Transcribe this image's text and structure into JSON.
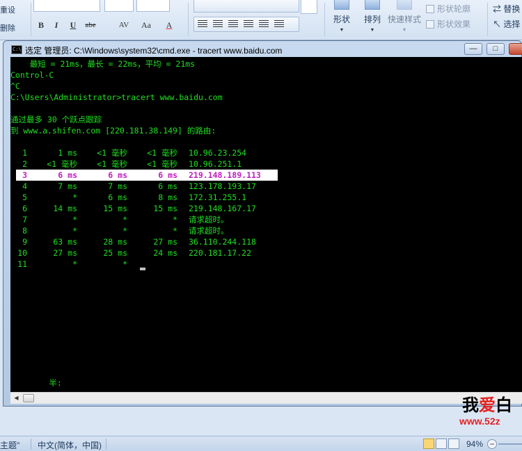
{
  "ribbon": {
    "left_labels": [
      "重设",
      "删除"
    ],
    "font_buttons": [
      "B",
      "I",
      "U",
      "abe",
      "AV",
      "Aa",
      "A"
    ],
    "groups": [
      {
        "label": "形状"
      },
      {
        "label": "排列"
      },
      {
        "label": "快速样式"
      }
    ],
    "shape_options": [
      "形状轮廓",
      "形状效果"
    ],
    "right_options": [
      "替换",
      "选择"
    ]
  },
  "cmd": {
    "title": "选定 管理员: C:\\Windows\\system32\\cmd.exe - tracert  www.baidu.com",
    "buttons": {
      "minimize": "—",
      "maximize": "□",
      "close": "✕"
    },
    "lines": {
      "l1": "    最短 = 21ms，最长 = 22ms，平均 = 21ms",
      "l2": "Control-C",
      "l3": "^C",
      "l4": "C:\\Users\\Administrator>tracert www.baidu.com",
      "l5": "通过最多 30 个跃点跟踪",
      "l6": "到 www.a.shifen.com [220.181.38.149] 的路由:",
      "footer": "        半:"
    },
    "hops": [
      {
        "n": "1",
        "t1": "1 ms",
        "t2": "<1 毫秒",
        "t3": "<1 毫秒",
        "addr": "10.96.23.254"
      },
      {
        "n": "2",
        "t1": "<1 毫秒",
        "t2": "<1 毫秒",
        "t3": "<1 毫秒",
        "addr": "10.96.251.1"
      },
      {
        "n": "3",
        "t1": "6 ms",
        "t2": "6 ms",
        "t3": "6 ms",
        "addr": "219.148.189.113"
      },
      {
        "n": "4",
        "t1": "7 ms",
        "t2": "7 ms",
        "t3": "6 ms",
        "addr": "123.178.193.17"
      },
      {
        "n": "5",
        "t1": "*",
        "t2": "6 ms",
        "t3": "8 ms",
        "addr": "172.31.255.1"
      },
      {
        "n": "6",
        "t1": "14 ms",
        "t2": "15 ms",
        "t3": "15 ms",
        "addr": "219.148.167.17"
      },
      {
        "n": "7",
        "t1": "*",
        "t2": "*",
        "t3": "*",
        "addr": "请求超时。"
      },
      {
        "n": "8",
        "t1": "*",
        "t2": "*",
        "t3": "*",
        "addr": "请求超时。"
      },
      {
        "n": "9",
        "t1": "63 ms",
        "t2": "28 ms",
        "t3": "27 ms",
        "addr": "36.110.244.118"
      },
      {
        "n": "10",
        "t1": "27 ms",
        "t2": "25 ms",
        "t3": "24 ms",
        "addr": "220.181.17.22"
      },
      {
        "n": "11",
        "t1": "*",
        "t2": "*",
        "t3": "",
        "addr": ""
      }
    ],
    "colors": {
      "console_bg": "#000000",
      "text": "#1fe01f",
      "selected_text": "#c01cc0",
      "selected_bg": "#ffffff"
    }
  },
  "watermark": {
    "brand_a": "我",
    "brand_b": "爱",
    "brand_c": "白",
    "url": "www.52z"
  },
  "statusbar": {
    "theme": "主题\"",
    "language": "中文(简体，中国)",
    "zoom": "94%",
    "minus": "−"
  }
}
